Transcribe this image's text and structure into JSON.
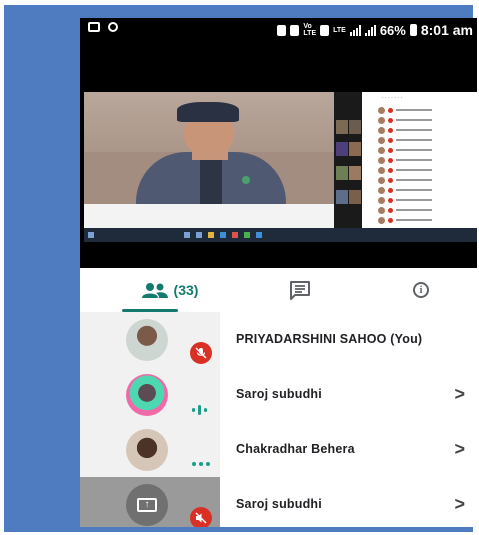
{
  "status_bar": {
    "network_label": "LTE",
    "battery": "66%",
    "time": "8:01 am"
  },
  "tabs": {
    "people": {
      "count": "(33)",
      "icon": "people-icon",
      "active": true
    },
    "chat": {
      "icon": "chat-icon"
    },
    "info": {
      "icon": "info-icon"
    }
  },
  "participants": [
    {
      "name": "PRIYADARSHINI SAHOO (You)",
      "status": "muted",
      "chevron": ""
    },
    {
      "name": "Saroj subudhi",
      "status": "speaking",
      "chevron": ">"
    },
    {
      "name": "Chakradhar Behera",
      "status": "idle",
      "chevron": ">"
    },
    {
      "name": "Saroj subudhi",
      "status": "presenting-muted",
      "chevron": ">"
    }
  ],
  "colors": {
    "accent": "#137a6e",
    "mute_red": "#d93025",
    "frame_blue": "#4f7bc0"
  }
}
